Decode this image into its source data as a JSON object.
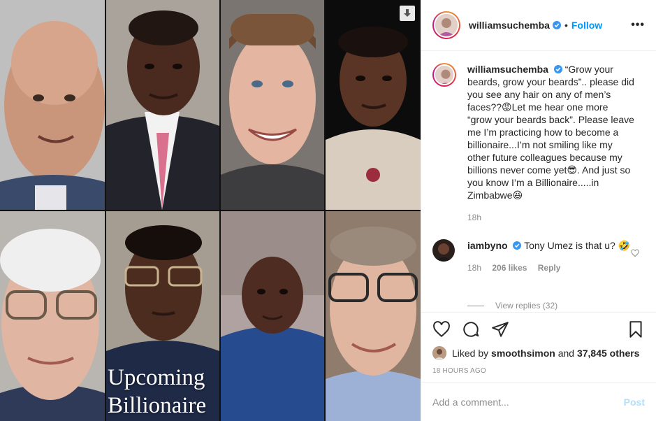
{
  "media": {
    "overlay_text_line1": "Upcoming",
    "overlay_text_line2": "Billionaire",
    "tiles": [
      "portrait-1",
      "portrait-2",
      "portrait-3",
      "portrait-4",
      "portrait-5",
      "portrait-6",
      "portrait-7",
      "portrait-8"
    ]
  },
  "header": {
    "username": "williamsuchemba",
    "follow_label": "Follow",
    "more_label": "•••"
  },
  "caption": {
    "username": "williamsuchemba",
    "text": "“Grow your beards, grow your beards”.. please did you see any hair on any of men’s faces??😡Let me hear one more “grow your beards back”. Please leave me I’m practicing how to become a billionaire...I’m not smiling like my other future colleagues because my billions never come yet😎. And just so you know I’m a Billionaire.....in Zimbabwe😆",
    "time": "18h"
  },
  "comment": {
    "username": "iambyno",
    "text": "Tony Umez is that u? 🤣",
    "time": "18h",
    "likes": "206 likes",
    "reply_label": "Reply",
    "view_replies": "View replies (32)"
  },
  "likes": {
    "prefix": "Liked by",
    "user": "smoothsimon",
    "and": "and",
    "others": "37,845 others"
  },
  "timestamp": "18 HOURS AGO",
  "add_comment": {
    "placeholder": "Add a comment...",
    "post_label": "Post"
  },
  "colors": {
    "accent": "#0095f6",
    "post_disabled": "#b2dffc",
    "muted": "#8e8e8e"
  },
  "icons": [
    "heart-icon",
    "comment-icon",
    "share-icon",
    "save-icon",
    "verified-icon",
    "download-icon"
  ]
}
